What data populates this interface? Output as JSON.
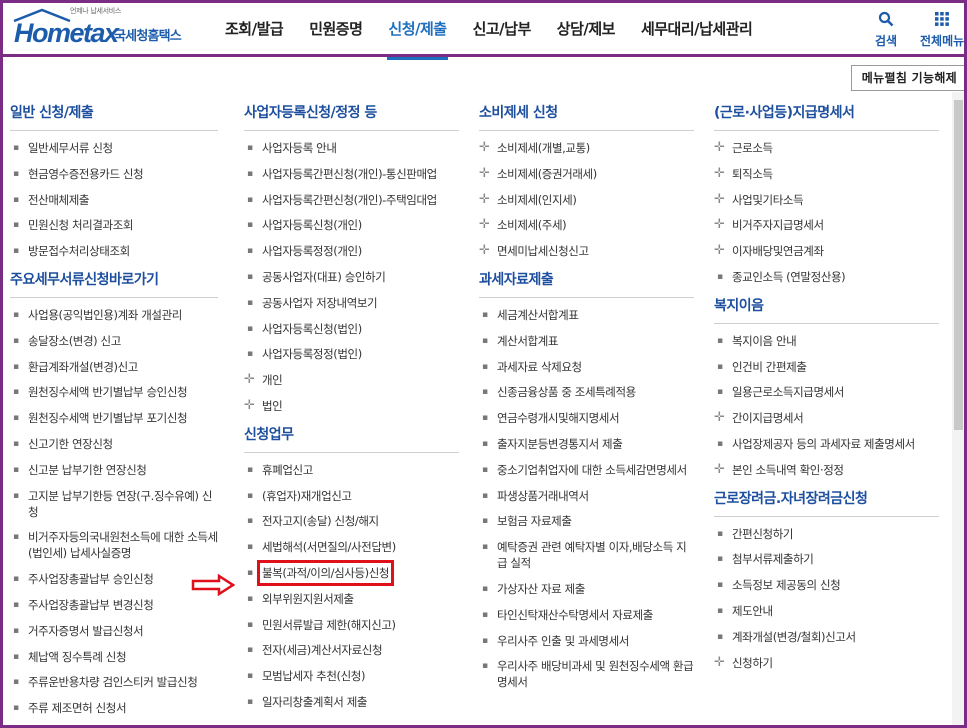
{
  "header": {
    "logo_sub": "언제나 납세서비스",
    "logo_text": "Hometax",
    "brand": "국세청홈택스",
    "nav": [
      "조회/발급",
      "민원증명",
      "신청/제출",
      "신고/납부",
      "상담/제보",
      "세무대리/납세관리"
    ],
    "active_nav": "신청/제출",
    "search_label": "검색",
    "allmenu_label": "전체메뉴"
  },
  "collapse_button": "메뉴펼침 기능해제",
  "colors": {
    "accent": "#1d4f9e",
    "frame": "#7b2d86",
    "highlight": "#e0101a"
  },
  "columns": [
    {
      "sections": [
        {
          "title": "일반 신청/제출",
          "items": [
            {
              "label": "일반세무서류 신청",
              "bullet": "dot"
            },
            {
              "label": "현금영수증전용카드 신청",
              "bullet": "dot"
            },
            {
              "label": "전산매체제출",
              "bullet": "dot"
            },
            {
              "label": "민원신청 처리결과조회",
              "bullet": "dot"
            },
            {
              "label": "방문접수처리상태조회",
              "bullet": "dot"
            }
          ]
        },
        {
          "title": "주요세무서류신청바로가기",
          "items": [
            {
              "label": "사업용(공익법인용)계좌 개설관리",
              "bullet": "dot"
            },
            {
              "label": "송달장소(변경) 신고",
              "bullet": "dot"
            },
            {
              "label": "환급계좌개설(변경)신고",
              "bullet": "dot"
            },
            {
              "label": "원천징수세액 반기별납부 승인신청",
              "bullet": "dot"
            },
            {
              "label": "원천징수세액 반기별납부 포기신청",
              "bullet": "dot"
            },
            {
              "label": "신고기한 연장신청",
              "bullet": "dot"
            },
            {
              "label": "신고분 납부기한 연장신청",
              "bullet": "dot"
            },
            {
              "label": "고지분 납부기한등 연장(구.징수유예) 신청",
              "bullet": "dot"
            },
            {
              "label": "비거주자등의국내원천소득에 대한 소득세(법인세) 납세사실증명",
              "bullet": "dot"
            },
            {
              "label": "주사업장총괄납부 승인신청",
              "bullet": "dot"
            },
            {
              "label": "주사업장총괄납부 변경신청",
              "bullet": "dot"
            },
            {
              "label": "거주자증명서 발급신청서",
              "bullet": "dot"
            },
            {
              "label": "체납액 징수특례 신청",
              "bullet": "dot"
            },
            {
              "label": "주류운반용차량 검인스티커 발급신청",
              "bullet": "dot"
            },
            {
              "label": "주류 제조면허 신청서",
              "bullet": "dot"
            }
          ]
        }
      ]
    },
    {
      "sections": [
        {
          "title": "사업자등록신청/정정 등",
          "items": [
            {
              "label": "사업자등록 안내",
              "bullet": "dot"
            },
            {
              "label": "사업자등록간편신청(개인)-통신판매업",
              "bullet": "dot"
            },
            {
              "label": "사업자등록간편신청(개인)-주택임대업",
              "bullet": "dot"
            },
            {
              "label": "사업자등록신청(개인)",
              "bullet": "dot"
            },
            {
              "label": "사업자등록정정(개인)",
              "bullet": "dot"
            },
            {
              "label": "공동사업자(대표) 승인하기",
              "bullet": "dot"
            },
            {
              "label": "공동사업자 저장내역보기",
              "bullet": "dot"
            },
            {
              "label": "사업자등록신청(법인)",
              "bullet": "dot"
            },
            {
              "label": "사업자등록정정(법인)",
              "bullet": "dot"
            },
            {
              "label": "개인",
              "bullet": "plus"
            },
            {
              "label": "법인",
              "bullet": "plus"
            }
          ]
        },
        {
          "title": "신청업무",
          "items": [
            {
              "label": "휴폐업신고",
              "bullet": "dot"
            },
            {
              "label": "(휴업자)재개업신고",
              "bullet": "dot"
            },
            {
              "label": "전자고지(송달) 신청/해지",
              "bullet": "dot"
            },
            {
              "label": "세법해석(서면질의/사전답변)",
              "bullet": "dot"
            },
            {
              "label": "불복(과적/이의/심사등)신청",
              "bullet": "dot",
              "highlight": true
            },
            {
              "label": "외부위원지원서제출",
              "bullet": "dot"
            },
            {
              "label": "민원서류발급 제한(해지신고)",
              "bullet": "dot"
            },
            {
              "label": "전자(세금)계산서자료신청",
              "bullet": "dot"
            },
            {
              "label": "모범납세자 추천(신청)",
              "bullet": "dot"
            },
            {
              "label": "일자리창출계획서 제출",
              "bullet": "dot"
            }
          ]
        }
      ]
    },
    {
      "sections": [
        {
          "title": "소비제세 신청",
          "items": [
            {
              "label": "소비제세(개별,교통)",
              "bullet": "plus"
            },
            {
              "label": "소비제세(증권거래세)",
              "bullet": "plus"
            },
            {
              "label": "소비제세(인지세)",
              "bullet": "plus"
            },
            {
              "label": "소비제세(주세)",
              "bullet": "plus"
            },
            {
              "label": "면세미납세신청신고",
              "bullet": "plus"
            }
          ]
        },
        {
          "title": "과세자료제출",
          "items": [
            {
              "label": "세금계산서합계표",
              "bullet": "dot"
            },
            {
              "label": "계산서합계표",
              "bullet": "dot"
            },
            {
              "label": "과세자료 삭제요청",
              "bullet": "dot"
            },
            {
              "label": "신종금융상품 중 조세특례적용",
              "bullet": "dot"
            },
            {
              "label": "연금수령개시및해지명세서",
              "bullet": "dot"
            },
            {
              "label": "출자지분등변경통지서 제출",
              "bullet": "dot"
            },
            {
              "label": "중소기업취업자에 대한 소득세감면명세서",
              "bullet": "dot"
            },
            {
              "label": "파생상품거래내역서",
              "bullet": "dot"
            },
            {
              "label": "보험금 자료제출",
              "bullet": "dot"
            },
            {
              "label": "예탁증권 관련 예탁자별 이자,배당소득 지급 실적",
              "bullet": "dot"
            },
            {
              "label": "가상자산 자료 제출",
              "bullet": "dot"
            },
            {
              "label": "타인신탁재산수탁명세서 자료제출",
              "bullet": "dot"
            },
            {
              "label": "우리사주 인출 및 과세명세서",
              "bullet": "dot"
            },
            {
              "label": "우리사주 배당비과세 및 원천징수세액 환급명세서",
              "bullet": "dot"
            }
          ]
        }
      ]
    },
    {
      "sections": [
        {
          "title": "(근로·사업등)지급명세서",
          "items": [
            {
              "label": "근로소득",
              "bullet": "plus"
            },
            {
              "label": "퇴직소득",
              "bullet": "plus"
            },
            {
              "label": "사업및기타소득",
              "bullet": "plus"
            },
            {
              "label": "비거주자지급명세서",
              "bullet": "plus"
            },
            {
              "label": "이자배당및연금계좌",
              "bullet": "plus"
            },
            {
              "label": "종교인소득 (연말정산용)",
              "bullet": "dot"
            }
          ]
        },
        {
          "title": "복지이음",
          "items": [
            {
              "label": "복지이음 안내",
              "bullet": "dot"
            },
            {
              "label": "인건비 간편제출",
              "bullet": "dot"
            },
            {
              "label": "일용근로소득지급명세서",
              "bullet": "dot"
            },
            {
              "label": "간이지급명세서",
              "bullet": "plus"
            },
            {
              "label": "사업장제공자 등의 과세자료 제출명세서",
              "bullet": "dot"
            },
            {
              "label": "본인 소득내역 확인·정정",
              "bullet": "plus"
            }
          ]
        },
        {
          "title": "근로장려금.자녀장려금신청",
          "items": [
            {
              "label": "간편신청하기",
              "bullet": "dot"
            },
            {
              "label": "첨부서류제출하기",
              "bullet": "dot"
            },
            {
              "label": "소득정보 제공동의 신청",
              "bullet": "dot"
            },
            {
              "label": "제도안내",
              "bullet": "dot"
            },
            {
              "label": "계좌개설(변경/철회)신고서",
              "bullet": "dot"
            },
            {
              "label": "신청하기",
              "bullet": "plus"
            }
          ]
        }
      ]
    }
  ]
}
